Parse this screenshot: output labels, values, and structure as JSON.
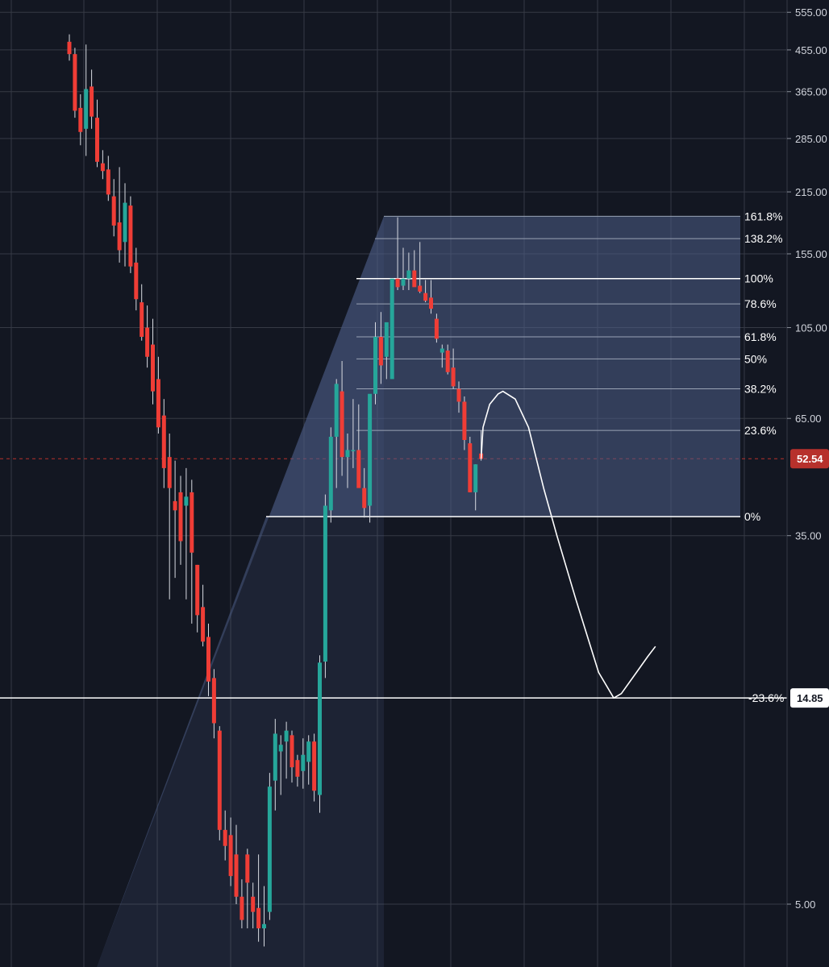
{
  "colors": {
    "background": "#131722",
    "grid": "#363a45",
    "up": "#26a69a",
    "down": "#ef3d36",
    "fib_fill": "#4f5f88",
    "fib_line": "#9aa3b5",
    "text": "#d1d4dc",
    "price_tag": "#b7312c",
    "projection": "#ffffff"
  },
  "chart_data": {
    "type": "candlestick",
    "price_scale": "log",
    "ylim": [
      3.9,
      600
    ],
    "y_ticks": [
      "555.00",
      "455.00",
      "365.00",
      "285.00",
      "215.00",
      "155.00",
      "105.00",
      "65.00",
      "35.00",
      "5.00"
    ],
    "y_tick_values": [
      555,
      455,
      365,
      285,
      215,
      155,
      105,
      65,
      35,
      5
    ],
    "last_price": {
      "label": "52.54",
      "value": 52.54
    },
    "level_tag": {
      "label": "14.85",
      "value": 14.85
    },
    "fibonacci": {
      "anchor_low": 38.7,
      "anchor_high": 136,
      "levels": [
        {
          "label": "161.8%",
          "value": 189
        },
        {
          "label": "138.2%",
          "value": 168
        },
        {
          "label": "100%",
          "value": 136
        },
        {
          "label": "78.6%",
          "value": 119
        },
        {
          "label": "61.8%",
          "value": 100
        },
        {
          "label": "50%",
          "value": 89
        },
        {
          "label": "38.2%",
          "value": 76
        },
        {
          "label": "23.6%",
          "value": 61
        },
        {
          "label": "0%",
          "value": 38.7
        },
        {
          "label": "-23.6%",
          "value": 14.85
        }
      ]
    },
    "candles": [
      [
        475,
        494,
        430,
        445
      ],
      [
        445,
        460,
        318,
        330
      ],
      [
        335,
        360,
        275,
        295
      ],
      [
        300,
        468,
        260,
        370
      ],
      [
        375,
        410,
        300,
        320
      ],
      [
        318,
        350,
        245,
        252
      ],
      [
        250,
        268,
        230,
        240
      ],
      [
        242,
        260,
        205,
        212
      ],
      [
        210,
        230,
        170,
        180
      ],
      [
        183,
        245,
        148,
        158
      ],
      [
        165,
        225,
        145,
        203
      ],
      [
        200,
        210,
        140,
        145
      ],
      [
        148,
        160,
        115,
        122
      ],
      [
        120,
        132,
        98,
        100
      ],
      [
        105,
        118,
        85,
        90
      ],
      [
        96,
        110,
        70,
        75
      ],
      [
        80,
        90,
        60,
        62
      ],
      [
        66,
        72,
        45,
        50
      ],
      [
        53,
        60,
        25,
        45
      ],
      [
        42,
        52,
        28,
        40
      ],
      [
        44,
        48,
        30,
        34
      ],
      [
        41,
        50,
        25,
        43
      ],
      [
        44,
        47,
        22,
        32
      ],
      [
        30,
        30,
        21,
        23
      ],
      [
        24,
        27,
        19.5,
        20
      ],
      [
        20.5,
        22,
        15,
        16.2
      ],
      [
        16.5,
        17.3,
        12,
        13
      ],
      [
        12.5,
        12.8,
        7,
        7.4
      ],
      [
        7.4,
        8.2,
        6.3,
        6.8
      ],
      [
        7.2,
        7.9,
        5.5,
        5.8
      ],
      [
        6.5,
        7.6,
        5.0,
        5.2
      ],
      [
        5.2,
        5.7,
        4.4,
        4.6
      ],
      [
        6.5,
        6.7,
        4.4,
        5.6
      ],
      [
        5.2,
        5.6,
        4.4,
        4.8
      ],
      [
        4.9,
        6.5,
        4.1,
        4.4
      ],
      [
        4.4,
        5.5,
        4.0,
        4.5
      ],
      [
        4.8,
        10,
        4.6,
        9.3
      ],
      [
        9.6,
        13.3,
        8.2,
        12.3
      ],
      [
        11.2,
        12.2,
        8.9,
        11.6
      ],
      [
        11.8,
        13.1,
        9.7,
        12.5
      ],
      [
        12.2,
        12.5,
        9.5,
        10.3
      ],
      [
        10.7,
        11.0,
        9.3,
        9.8
      ],
      [
        10.1,
        12.0,
        9.2,
        11.0
      ],
      [
        10.6,
        12.2,
        9.4,
        11.8
      ],
      [
        11.8,
        12.3,
        8.6,
        9.1
      ],
      [
        8.9,
        18.6,
        8.1,
        17.9
      ],
      [
        18,
        43.5,
        16.5,
        41
      ],
      [
        40,
        62,
        37.5,
        59
      ],
      [
        59,
        80,
        45,
        78
      ],
      [
        75,
        88,
        48,
        53
      ],
      [
        53,
        60,
        45,
        55
      ],
      [
        55,
        72,
        50,
        55
      ],
      [
        55,
        70,
        48,
        45
      ],
      [
        45,
        50,
        38.5,
        40.5
      ],
      [
        41,
        60,
        37.5,
        74
      ],
      [
        74,
        108,
        70,
        100
      ],
      [
        100,
        114,
        78,
        86
      ],
      [
        90,
        105,
        80,
        108
      ],
      [
        80,
        130,
        90,
        136
      ],
      [
        136,
        188,
        128,
        130
      ],
      [
        131,
        160,
        128,
        136
      ],
      [
        136,
        156,
        128,
        142
      ],
      [
        142,
        158,
        131,
        130
      ],
      [
        131,
        165,
        126,
        127
      ],
      [
        126,
        135,
        120,
        121
      ],
      [
        123,
        135,
        113,
        116
      ],
      [
        110,
        113,
        97,
        99
      ],
      [
        92,
        96,
        85,
        94
      ],
      [
        93,
        96,
        82,
        83
      ],
      [
        85,
        94,
        76,
        77
      ],
      [
        76,
        79,
        67,
        71
      ],
      [
        71,
        73,
        55,
        58
      ],
      [
        57,
        59,
        44,
        44
      ],
      [
        44,
        51,
        40,
        51
      ],
      [
        54,
        61,
        52,
        52.5
      ]
    ],
    "projection_path": [
      [
        52.5,
        0
      ],
      [
        62,
        0.1
      ],
      [
        70,
        0.45
      ],
      [
        74,
        0.9
      ],
      [
        75,
        1.15
      ],
      [
        72,
        1.8
      ],
      [
        62,
        2.5
      ],
      [
        45,
        3.3
      ],
      [
        35,
        4.0
      ],
      [
        25,
        5.0
      ],
      [
        17,
        6.2
      ],
      [
        14.85,
        7.0
      ],
      [
        15.2,
        7.4
      ],
      [
        17.0,
        8.2
      ],
      [
        18.5,
        8.8
      ],
      [
        19.5,
        9.2
      ]
    ]
  }
}
